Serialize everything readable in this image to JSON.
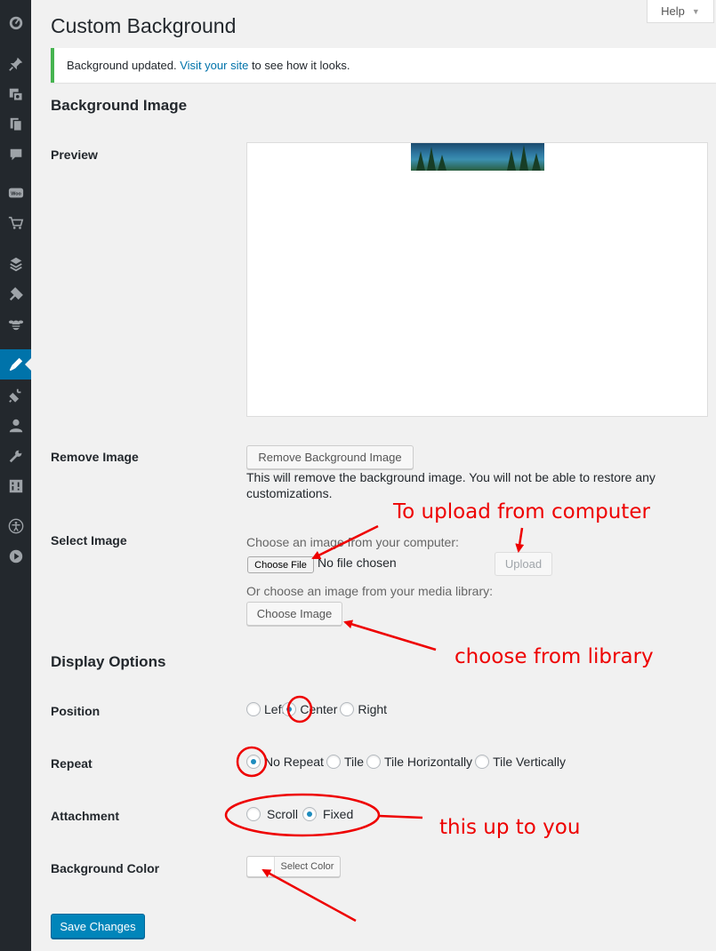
{
  "sidebar": {
    "icons": [
      "dashboard-icon",
      "pin-icon",
      "media-icon",
      "pages-icon",
      "comments-icon",
      "woo-icon",
      "cart-icon",
      "layers-icon",
      "tools-icon",
      "bee-icon",
      "appearance-icon",
      "plugins-icon",
      "users-icon",
      "wrench-icon",
      "settings-icon",
      "accessibility-icon",
      "play-icon"
    ],
    "woo_text": "Woo"
  },
  "help": {
    "label": "Help"
  },
  "page": {
    "title": "Custom Background"
  },
  "notice": {
    "text_before": "Background updated.",
    "link": "Visit your site",
    "text_after": "to see how it looks."
  },
  "background_image": {
    "heading": "Background Image",
    "preview_label": "Preview",
    "remove_label": "Remove Image",
    "remove_button": "Remove Background Image",
    "remove_desc": "This will remove the background image. You will not be able to restore any customizations.",
    "select_label": "Select Image",
    "choose_computer": "Choose an image from your computer:",
    "choose_file_button": "Choose File",
    "no_file": "No file chosen",
    "upload_button": "Upload",
    "choose_library": "Or choose an image from your media library:",
    "choose_image_button": "Choose Image"
  },
  "display_options": {
    "heading": "Display Options",
    "position": {
      "label": "Position",
      "options": [
        {
          "label": "Left",
          "checked": false
        },
        {
          "label": "Center",
          "checked": true
        },
        {
          "label": "Right",
          "checked": false
        }
      ]
    },
    "repeat": {
      "label": "Repeat",
      "options": [
        {
          "label": "No Repeat",
          "checked": true
        },
        {
          "label": "Tile",
          "checked": false
        },
        {
          "label": "Tile Horizontally",
          "checked": false
        },
        {
          "label": "Tile Vertically",
          "checked": false
        }
      ]
    },
    "attachment": {
      "label": "Attachment",
      "options": [
        {
          "label": "Scroll",
          "checked": false
        },
        {
          "label": "Fixed",
          "checked": true
        }
      ]
    },
    "background_color": {
      "label": "Background Color",
      "button": "Select Color"
    }
  },
  "save_button": "Save Changes",
  "annotations": {
    "upload": "To upload from computer",
    "library": "choose from library",
    "attachment": "this up to you"
  },
  "colors": {
    "annotation": "#e00000",
    "primary": "#0085ba",
    "sidebar": "#23282d",
    "notice_border": "#46b450"
  }
}
